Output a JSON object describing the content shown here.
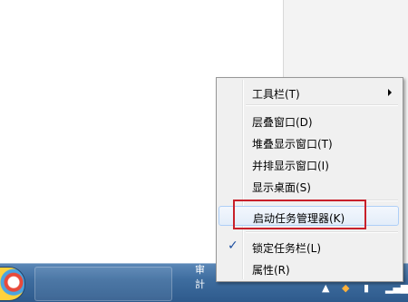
{
  "context_menu": {
    "items": [
      {
        "label": "工具栏(T)",
        "has_submenu": true
      },
      {
        "label": "层叠窗口(D)"
      },
      {
        "label": "堆叠显示窗口(T)"
      },
      {
        "label": "并排显示窗口(I)"
      },
      {
        "label": "显示桌面(S)"
      },
      {
        "label": "启动任务管理器(K)",
        "highlighted": true
      },
      {
        "label": "锁定任务栏(L)",
        "checked": true
      },
      {
        "label": "属性(R)"
      }
    ]
  },
  "taskbar": {
    "window_button_text": "审計"
  },
  "colors": {
    "accent_box": "#c8202a",
    "taskbar": "#3e6d9f"
  }
}
